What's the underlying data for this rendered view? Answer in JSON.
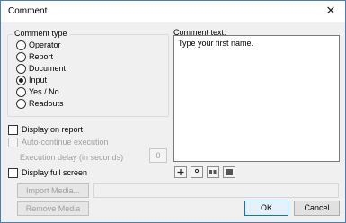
{
  "window": {
    "title": "Comment"
  },
  "comment_type": {
    "legend": "Comment type",
    "options": [
      {
        "label": "Operator",
        "checked": false
      },
      {
        "label": "Report",
        "checked": false
      },
      {
        "label": "Document",
        "checked": false
      },
      {
        "label": "Input",
        "checked": true
      },
      {
        "label": "Yes / No",
        "checked": false
      },
      {
        "label": "Readouts",
        "checked": false
      }
    ]
  },
  "options": {
    "display_on_report": "Display on report",
    "auto_continue": "Auto-continue execution",
    "execution_delay_label": "Execution delay (in seconds)",
    "execution_delay_value": "0",
    "display_full_screen": "Display full screen"
  },
  "media": {
    "import_label": "Import Media...",
    "remove_label": "Remove Media",
    "path_value": ""
  },
  "comment": {
    "label": "Comment text:",
    "value": "Type your first name."
  },
  "toolbar": {
    "icons": [
      "plus-icon",
      "degree-icon",
      "grid-small-icon",
      "grid-large-icon"
    ]
  },
  "buttons": {
    "ok": "OK",
    "cancel": "Cancel"
  },
  "colors": {
    "accent": "#0078d7",
    "window_border": "#4a7ebb",
    "disabled_text": "#a0a0a0"
  }
}
